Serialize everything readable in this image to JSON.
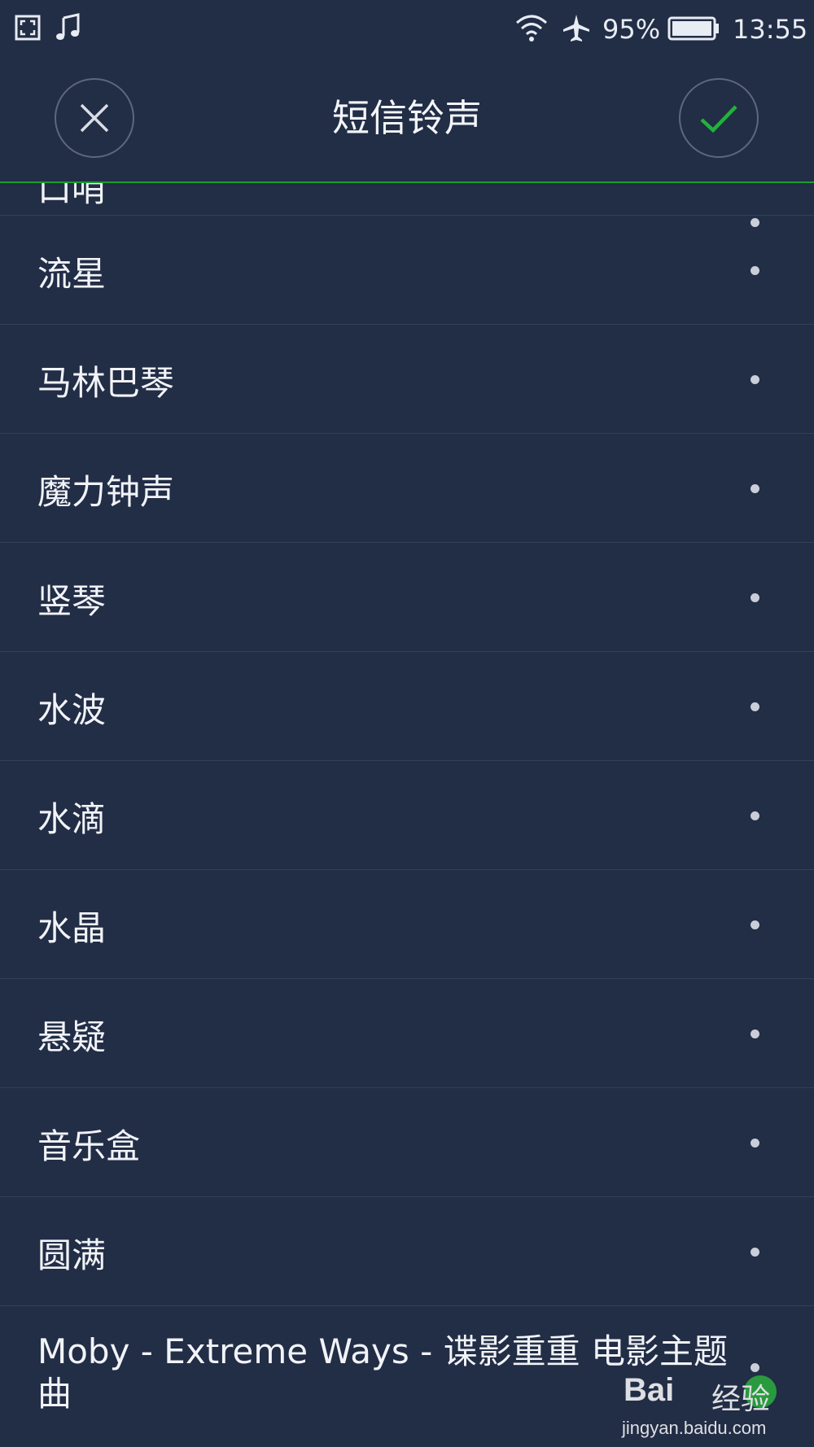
{
  "status_bar": {
    "battery_percent": "95%",
    "time": "13:55",
    "icons": [
      "screenshot-icon",
      "music-note-icon",
      "wifi-icon",
      "airplane-icon",
      "battery-icon"
    ]
  },
  "header": {
    "title": "短信铃声",
    "close_icon": "close-icon",
    "confirm_icon": "check-icon"
  },
  "colors": {
    "background": "#222d46",
    "accent_green": "#1a9e2f",
    "divider": "#34405a"
  },
  "ringtones": [
    {
      "label": "口哨"
    },
    {
      "label": "流星"
    },
    {
      "label": "马林巴琴"
    },
    {
      "label": "魔力钟声"
    },
    {
      "label": "竖琴"
    },
    {
      "label": "水波"
    },
    {
      "label": "水滴"
    },
    {
      "label": "水晶"
    },
    {
      "label": "悬疑"
    },
    {
      "label": "音乐盒"
    },
    {
      "label": "圆满"
    },
    {
      "label": "Moby - Extreme Ways - 谍影重重 电影主题曲"
    }
  ],
  "watermark": {
    "brand": "Bai",
    "brand_cn": "经验",
    "url": "jingyan.baidu.com"
  }
}
